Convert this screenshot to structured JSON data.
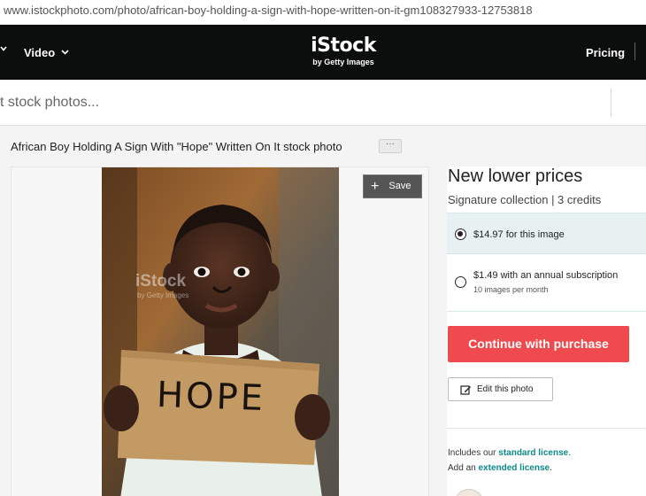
{
  "browser": {
    "url": "www.istockphoto.com/photo/african-boy-holding-a-sign-with-hope-written-on-it-gm108327933-12753818"
  },
  "header": {
    "nav_video_label": "Video",
    "logo_text": "iStock",
    "logo_subtext": "by Getty Images",
    "pricing_label": "Pricing"
  },
  "search": {
    "placeholder": "t stock photos..."
  },
  "page": {
    "title": "African Boy Holding A Sign With \"Hope\" Written On It stock photo",
    "more_label": "···"
  },
  "image": {
    "save_label": "Save",
    "sign_text": "HOPE",
    "watermark": "iStock",
    "watermark_sub": "by Getty Images"
  },
  "purchase": {
    "heading": "New lower prices",
    "subheading": "Signature collection | 3 credits",
    "options": [
      {
        "label": "$14.97 for this image",
        "selected": true
      },
      {
        "label": "$1.49 with an annual subscription",
        "sublabel": "10 images per month",
        "selected": false
      }
    ],
    "continue_label": "Continue with purchase",
    "edit_label": "Edit this photo",
    "license_line1_prefix": "Includes our ",
    "license_line1_link": "standard license",
    "license_line1_suffix": ".",
    "license_line2_prefix": "Add an ",
    "license_line2_link": "extended license",
    "license_line2_suffix": "."
  },
  "colors": {
    "accent_red": "#ef4a4d",
    "link_teal": "#0d8a8a",
    "header_black": "#0c0d0d"
  }
}
